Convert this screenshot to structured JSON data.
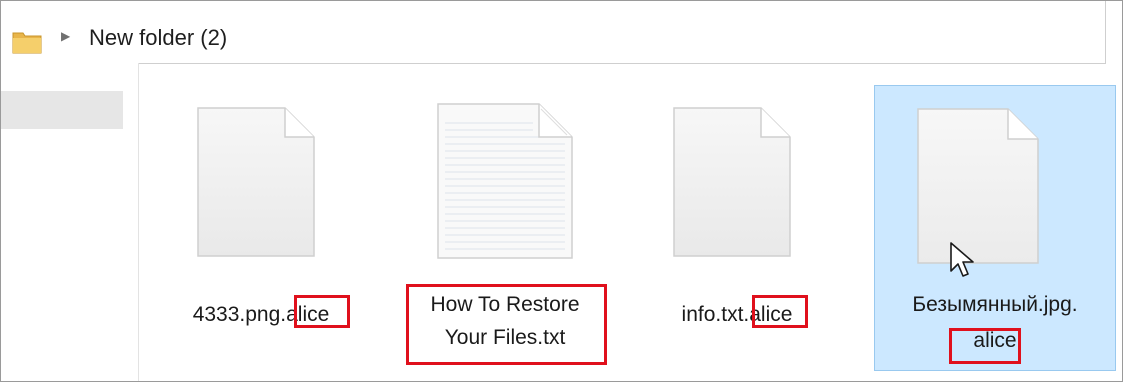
{
  "window": {
    "breadcrumb": "New folder (2)"
  },
  "files": [
    {
      "name_line1": "4333.png.alice",
      "name_line2": "",
      "icon": "blank-document-icon",
      "selected": false
    },
    {
      "name_line1": "How To Restore",
      "name_line2": "Your Files.txt",
      "icon": "text-document-icon",
      "selected": false
    },
    {
      "name_line1": "info.txt.alice",
      "name_line2": "",
      "icon": "blank-document-icon",
      "selected": false
    },
    {
      "name_line1": "Безымянный.jpg.",
      "name_line2": "alice",
      "icon": "blank-document-icon",
      "selected": true
    }
  ],
  "colors": {
    "highlight": "#e0101c",
    "selection": "#cce8ff",
    "selection_border": "#99c9ef"
  }
}
